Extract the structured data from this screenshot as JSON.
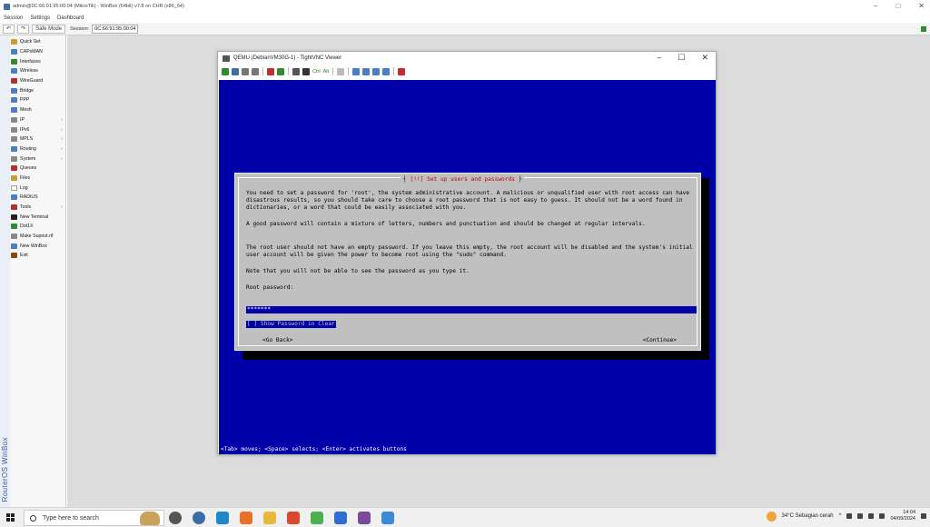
{
  "winbox": {
    "title": "admin@0C:66:91:95:00:04 (MikroTik) - WinBox (64bit) v7.8 on CHR (x86_64)",
    "menu": [
      "Session",
      "Settings",
      "Dashboard"
    ],
    "toolbar": {
      "safe_mode": "Safe Mode",
      "session_label": "Session:",
      "session_value": "0C:66:91:95:00:04"
    },
    "vertical_label": "RouterOS WinBox",
    "sidebar": [
      {
        "label": "Quick Set",
        "icon": "quick-set-icon",
        "color": "#c8a030",
        "arrow": ""
      },
      {
        "label": "CAPsMAN",
        "icon": "capsman-icon",
        "color": "#4a7ec8",
        "arrow": ""
      },
      {
        "label": "Interfaces",
        "icon": "interfaces-icon",
        "color": "#2e8b2e",
        "arrow": ""
      },
      {
        "label": "Wireless",
        "icon": "wireless-icon",
        "color": "#4a7ec8",
        "arrow": ""
      },
      {
        "label": "WireGuard",
        "icon": "wireguard-icon",
        "color": "#b03030",
        "arrow": ""
      },
      {
        "label": "Bridge",
        "icon": "bridge-icon",
        "color": "#4a7ec8",
        "arrow": ""
      },
      {
        "label": "PPP",
        "icon": "ppp-icon",
        "color": "#4a7ec8",
        "arrow": ""
      },
      {
        "label": "Mesh",
        "icon": "mesh-icon",
        "color": "#4a7ec8",
        "arrow": ""
      },
      {
        "label": "IP",
        "icon": "ip-icon",
        "color": "#888888",
        "arrow": "›"
      },
      {
        "label": "IPv6",
        "icon": "ipv6-icon",
        "color": "#888888",
        "arrow": "›"
      },
      {
        "label": "MPLS",
        "icon": "mpls-icon",
        "color": "#888888",
        "arrow": "›"
      },
      {
        "label": "Routing",
        "icon": "routing-icon",
        "color": "#4a7ec8",
        "arrow": "›"
      },
      {
        "label": "System",
        "icon": "system-icon",
        "color": "#888888",
        "arrow": "›"
      },
      {
        "label": "Queues",
        "icon": "queues-icon",
        "color": "#b03030",
        "arrow": ""
      },
      {
        "label": "Files",
        "icon": "files-icon",
        "color": "#c8a030",
        "arrow": ""
      },
      {
        "label": "Log",
        "icon": "log-icon",
        "color": "#ffffff",
        "arrow": ""
      },
      {
        "label": "RADIUS",
        "icon": "radius-icon",
        "color": "#4a7ec8",
        "arrow": ""
      },
      {
        "label": "Tools",
        "icon": "tools-icon",
        "color": "#b03030",
        "arrow": "›"
      },
      {
        "label": "New Terminal",
        "icon": "terminal-icon",
        "color": "#222222",
        "arrow": ""
      },
      {
        "label": "Dot1X",
        "icon": "dot1x-icon",
        "color": "#2e8b2e",
        "arrow": ""
      },
      {
        "label": "Make Supout.rif",
        "icon": "supout-icon",
        "color": "#888888",
        "arrow": ""
      },
      {
        "label": "New WinBox",
        "icon": "winbox-icon",
        "color": "#4a7ec8",
        "arrow": ""
      },
      {
        "label": "Exit",
        "icon": "exit-icon",
        "color": "#8b4513",
        "arrow": ""
      }
    ]
  },
  "vnc": {
    "title": "QEMU (DebianVM30G-1) - TightVNC Viewer",
    "toolbar_text": [
      "Ctrl",
      "Alt"
    ]
  },
  "installer": {
    "title_bracket_open": "┤",
    "title": "[!!] Set up users and passwords",
    "title_bracket_close": "├",
    "p1": "You need to set a password for 'root', the system administrative account. A malicious or unqualified user with root access can have disastrous results, so you should take care to choose a root password that is not easy to guess. It should not be a word found in dictionaries, or a word that could be easily associated with you.",
    "p2": "A good password will contain a mixture of letters, numbers and punctuation and should be changed at regular intervals.",
    "p3": "The root user should not have an empty password. If you leave this empty, the root account will be disabled and the system's initial user account will be given the power to become root using the \"sudo\" command.",
    "p4": "Note that you will not be able to see the password as you type it.",
    "prompt": "Root password:",
    "password_mask": "*******",
    "show_password": "[ ] Show Password in Clear",
    "go_back": "<Go Back>",
    "continue": "<Continue>",
    "status": "<Tab> moves; <Space> selects; <Enter> activates buttons"
  },
  "taskbar": {
    "search_placeholder": "Type here to search",
    "weather": "34°C  Sebagian cerah",
    "time": "14:04",
    "date": "04/09/2024",
    "apps": [
      {
        "name": "task-view-icon",
        "color": "#555555"
      },
      {
        "name": "widgets-icon",
        "color": "#3a6ea5"
      },
      {
        "name": "edge-icon",
        "color": "#1e88c8"
      },
      {
        "name": "firefox-icon",
        "color": "#e8712a"
      },
      {
        "name": "file-explorer-icon",
        "color": "#e8b83a"
      },
      {
        "name": "chrome-icon",
        "color": "#d9482f"
      },
      {
        "name": "app-icon",
        "color": "#4caf50"
      },
      {
        "name": "app-icon-2",
        "color": "#2f6fd0"
      },
      {
        "name": "winbox-taskbar-icon",
        "color": "#7a4a9a"
      },
      {
        "name": "tightvnc-icon",
        "color": "#3a8ad8"
      }
    ]
  }
}
